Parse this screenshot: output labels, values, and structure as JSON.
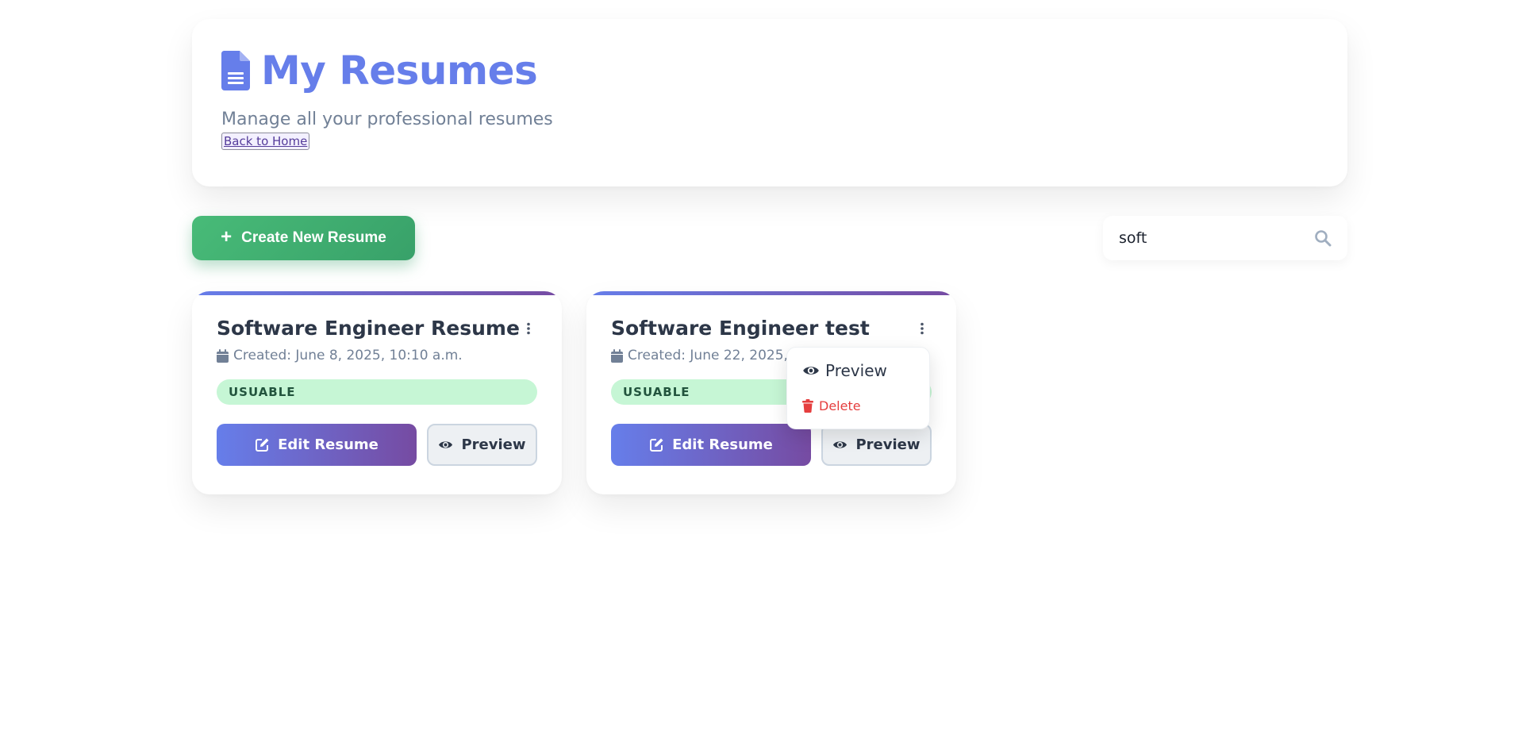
{
  "header": {
    "title": "My Resumes",
    "subtitle": "Manage all your professional resumes",
    "back_link": "Back to Home"
  },
  "toolbar": {
    "create_label": "Create New Resume",
    "search_value": "soft"
  },
  "resumes": [
    {
      "title": "Software Engineer Resume",
      "created": "Created: June 8, 2025, 10:10 a.m.",
      "status": "USUABLE",
      "edit_label": "Edit Resume",
      "preview_label": "Preview"
    },
    {
      "title": "Software Engineer test",
      "created": "Created: June 22, 2025, 4",
      "status": "USUABLE",
      "edit_label": "Edit Resume",
      "preview_label": "Preview"
    }
  ],
  "dropdown": {
    "preview_label": "Preview",
    "delete_label": "Delete"
  },
  "colors": {
    "accent": "#667eea",
    "accent_end": "#764ba2",
    "create_green": "#48bb78",
    "status_bg": "#c6f6d5",
    "delete_red": "#e53e3e"
  },
  "icons": {
    "title": "document-icon",
    "create": "plus-icon",
    "search": "search-icon",
    "menu": "kebab-menu-icon",
    "date": "calendar-icon",
    "edit": "edit-icon",
    "preview": "eye-icon",
    "delete": "trash-icon"
  }
}
